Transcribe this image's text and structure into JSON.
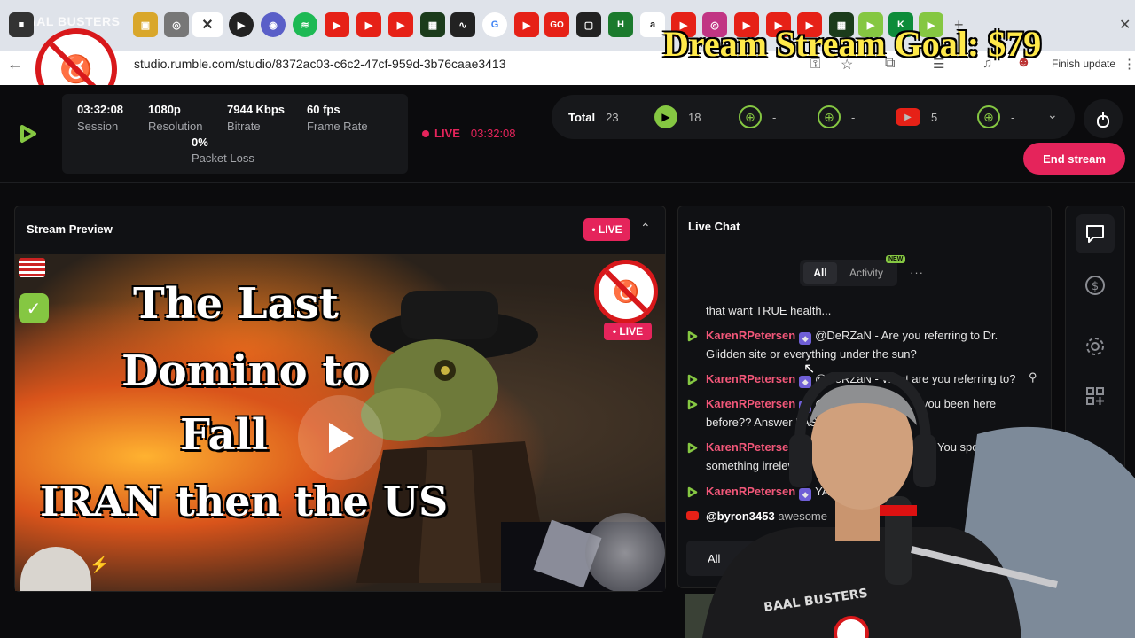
{
  "browser": {
    "channel_text": "BAAL BUSTERS",
    "url": "studio.rumble.com/studio/8372ac03-c6c2-47cf-959d-3b76caae3413",
    "finish_update": "Finish update",
    "tab_labels": [
      "GO",
      "K"
    ]
  },
  "overlay": {
    "goal_text": "Dream Stream Goal: $79"
  },
  "stats": {
    "session_value": "03:32:08",
    "session_label": "Session",
    "resolution_value": "1080p",
    "resolution_label": "Resolution",
    "bitrate_value": "7944 Kbps",
    "bitrate_label": "Bitrate",
    "framerate_value": "60 fps",
    "framerate_label": "Frame Rate",
    "packetloss_value": "0%",
    "packetloss_label": "Packet Loss"
  },
  "live_status": {
    "label": "LIVE",
    "time": "03:32:08"
  },
  "platforms": {
    "total_label": "Total",
    "total_count": "23",
    "rumble_count": "18",
    "web1_count": "-",
    "web2_count": "-",
    "youtube_count": "5",
    "web3_count": "-"
  },
  "end_stream_label": "End stream",
  "preview": {
    "title": "Stream Preview",
    "live_badge": "• LIVE",
    "thumb_live": "• LIVE",
    "thumb_lines": [
      "The Last",
      "Domino to",
      "Fall",
      "IRAN then the US"
    ]
  },
  "chat": {
    "title": "Live Chat",
    "tab_all": "All",
    "tab_activity": "Activity",
    "new_badge": "NEW",
    "more": "···",
    "messages": [
      {
        "user": "",
        "text": "that want TRUE health..."
      },
      {
        "user": "KarenRPetersen",
        "text": "@DeRZaN - Are you referring to Dr.",
        "text2": "Glidden site or everything under the sun?"
      },
      {
        "user": "KarenRPetersen",
        "text": "@DeRZaN - What are you referring to?"
      },
      {
        "user": "KarenRPetersen",
        "text": "@",
        "text_right": "you been here",
        "text2": "before?? Answer FAST!"
      },
      {
        "user": "KarenRPetersen",
        "text": "",
        "text_right": "You spouted off",
        "text2": "something irrelevant"
      },
      {
        "user": "KarenRPetersen",
        "text": "YAY!"
      },
      {
        "user": "@byron3453",
        "text": "awesome"
      }
    ],
    "filter_value": "All"
  },
  "colors": {
    "accent": "#e5245b",
    "rumble_green": "#85c742",
    "username": "#f25779",
    "goal_yellow": "#ffe94a"
  },
  "icons": {
    "sidebar": [
      "chat-icon",
      "dollar-icon",
      "settings-icon",
      "add-widget-icon"
    ],
    "lock": "touch-lock-icon"
  }
}
